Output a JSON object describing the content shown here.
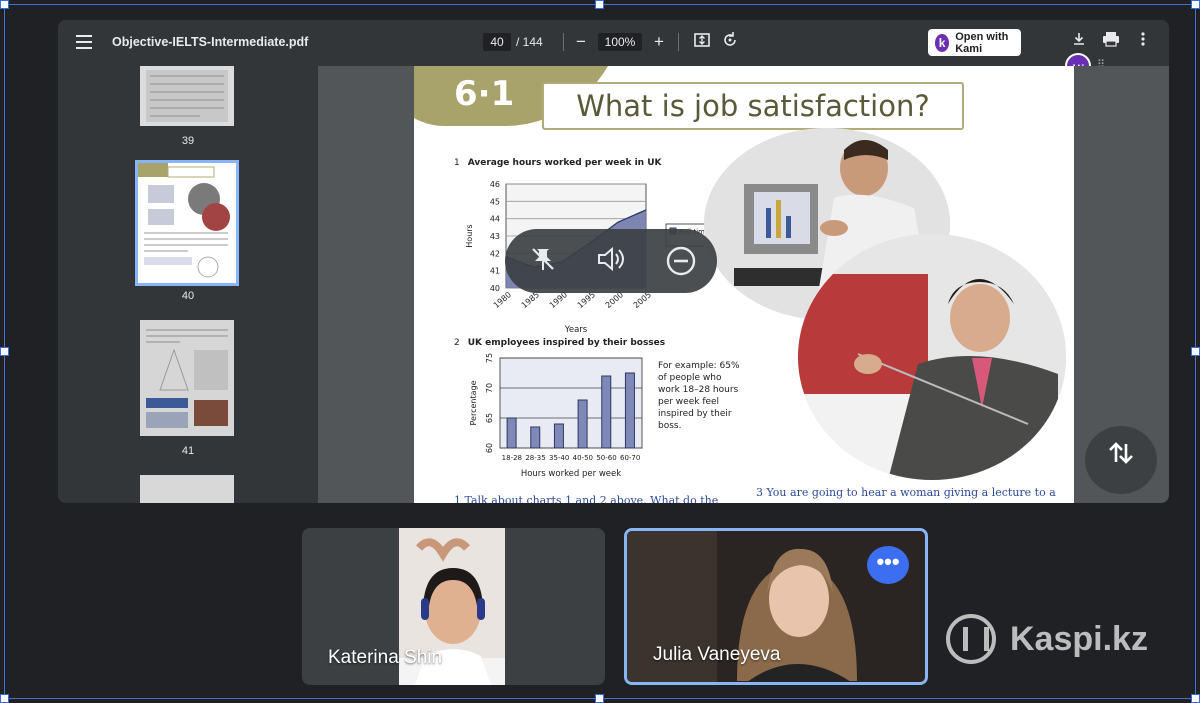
{
  "pdf_viewer": {
    "file_name": "Objective-IELTS-Intermediate.pdf",
    "current_page": "40",
    "page_total": "/ 144",
    "zoom": "100%",
    "zoom_out_icon": "minus-icon",
    "zoom_in_icon": "plus-icon",
    "open_with_kami_label": "Open with Kami",
    "kami_logo_letter": "k",
    "extension_letter": "w",
    "thumbnails": [
      {
        "number": "39"
      },
      {
        "number": "40",
        "active": true
      },
      {
        "number": "41"
      }
    ]
  },
  "document_page": {
    "unit_number": "6·1",
    "title": "What is job satisfaction?",
    "chart1": {
      "number": "1",
      "heading": "Average hours worked per week in UK",
      "legend": "Full-time workers"
    },
    "chart2": {
      "number": "2",
      "heading": "UK employees inspired by their bosses",
      "note": "For example: 65% of people who work 18–28 hours per week feel inspired by their boss."
    },
    "footer_left": "1   Talk about charts 1 and 2 above. What do the",
    "footer_right": "3   You are going to hear a woman giving a lecture to a"
  },
  "chart_data": [
    {
      "type": "area",
      "title": "Average hours worked per week in UK",
      "xlabel": "Years",
      "ylabel": "Hours",
      "x": [
        1980,
        1985,
        1990,
        1995,
        2000,
        2005
      ],
      "series": [
        {
          "name": "Full-time workers",
          "values": [
            41.8,
            41.2,
            41.5,
            42.6,
            43.8,
            44.5
          ]
        }
      ],
      "ylim": [
        40,
        46
      ],
      "yticks": [
        40,
        41,
        42,
        43,
        44,
        45,
        46
      ],
      "xticks": [
        "1980",
        "1985",
        "1990",
        "1995",
        "2000",
        "2005"
      ],
      "grid": true
    },
    {
      "type": "bar",
      "title": "UK employees inspired by their bosses",
      "xlabel": "Hours worked per week",
      "ylabel": "Percentage",
      "categories": [
        "18-28",
        "28-35",
        "35-40",
        "40-50",
        "50-60",
        "60-70"
      ],
      "values": [
        65,
        63.5,
        64,
        68,
        72,
        72.5
      ],
      "ylim": [
        60,
        75
      ],
      "yticks": [
        60,
        65,
        70,
        75
      ],
      "grid": true
    }
  ],
  "overlay_controls": {
    "unpin_icon": "pin-off-icon",
    "volume_icon": "volume-icon",
    "remove_icon": "remove-circle-icon"
  },
  "participants": [
    {
      "name": "Katerina Shin",
      "active": false
    },
    {
      "name": "Julia Vaneyeva",
      "active": true,
      "more_label": "•••"
    }
  ],
  "watermark": "Kaspi.kz",
  "colors": {
    "background": "#202124",
    "viewer_toolbar": "#323639",
    "active_accent": "#8ab4f8",
    "more_button": "#3b6ef0",
    "kami_purple": "#6b2fb3"
  }
}
